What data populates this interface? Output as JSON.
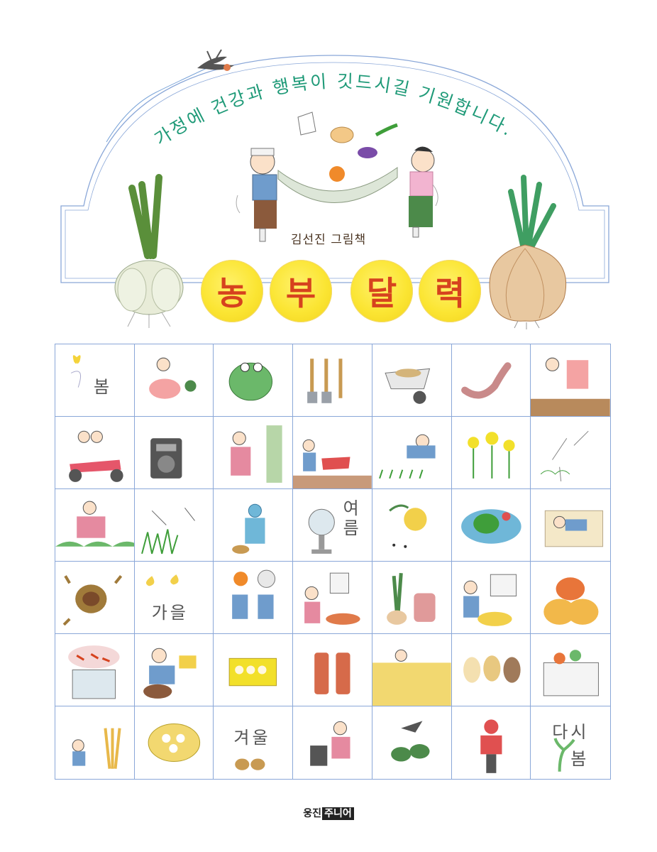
{
  "blessing": "가정에 건강과 행복이 깃드시길 기원합니다.",
  "author": "김선진 그림책",
  "title_chars": [
    "농",
    "부",
    "달",
    "력"
  ],
  "seasons": {
    "spring": "봄",
    "summer": "여름",
    "autumn": "가을",
    "winter": "겨울",
    "again": "다시",
    "again_spring": "봄"
  },
  "publisher": {
    "name": "웅진",
    "tag": "주니어"
  },
  "colors": {
    "blessing_text": "#1f9a78",
    "title_text": "#d6421e",
    "title_circle": "#fbe533",
    "grid_line": "#8aa7d8"
  },
  "grid_cells": [
    "butterfly-spring",
    "woman-weeding",
    "frog",
    "garden-tools",
    "wheelbarrow",
    "earthworm",
    "woman-planting",
    "couple-motorbike",
    "radio",
    "woman-sprinkling",
    "farmer-tiller",
    "farmer-rice-planting",
    "rapeseed-flowers",
    "dandelion-seeds",
    "woman-field",
    "dragonflies",
    "farmer-rain",
    "fan-summer",
    "melon-ants",
    "watermelon-bowl",
    "summer-nap",
    "chestnut",
    "ginkgo-autumn",
    "couple-harvest",
    "woman-pouring",
    "scallion-basket",
    "farmer-raking",
    "pumpkins",
    "chili-sack",
    "man-repairing",
    "egg-crate",
    "oil-bottles",
    "rice-field-harvest",
    "puppies",
    "produce-box",
    "child-straw",
    "table-dishes",
    "shoes-winter",
    "woman-cooking",
    "bird-on-plant",
    "farmer-winter-bike",
    "sprout-again"
  ]
}
